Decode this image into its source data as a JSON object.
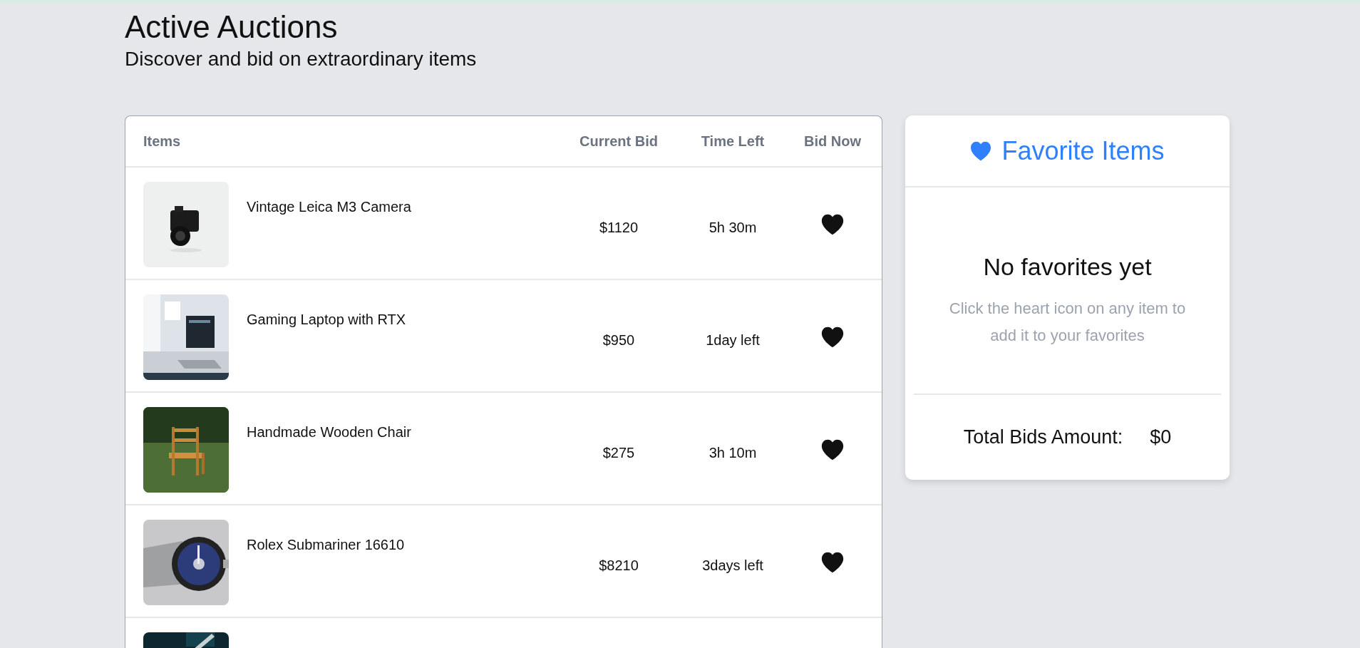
{
  "header": {
    "title": "Active Auctions",
    "subtitle": "Discover and bid on extraordinary items"
  },
  "table": {
    "columns": [
      "Items",
      "Current Bid",
      "Time Left",
      "Bid Now"
    ],
    "rows": [
      {
        "kind": "item",
        "name": "Vintage Leica M3 Camera",
        "current_bid": "$1120",
        "time_left": "5h 30m",
        "favorited": false
      },
      {
        "kind": "item",
        "name": "Gaming Laptop with RTX",
        "current_bid": "$950",
        "time_left": "1day left",
        "favorited": false
      },
      {
        "kind": "item",
        "name": "Handmade Wooden Chair",
        "current_bid": "$275",
        "time_left": "3h 10m",
        "favorited": false
      },
      {
        "kind": "item",
        "name": "Rolex Submariner 16610",
        "current_bid": "$8210",
        "time_left": "3days left",
        "favorited": false
      },
      {
        "kind": "picture"
      }
    ]
  },
  "favorites": {
    "title": "Favorite Items",
    "empty_title": "No favorites yet",
    "empty_hint": "Click the heart icon on any item to add it to your favorites",
    "total_label": "Total Bids Amount:",
    "total_value": "$0"
  }
}
